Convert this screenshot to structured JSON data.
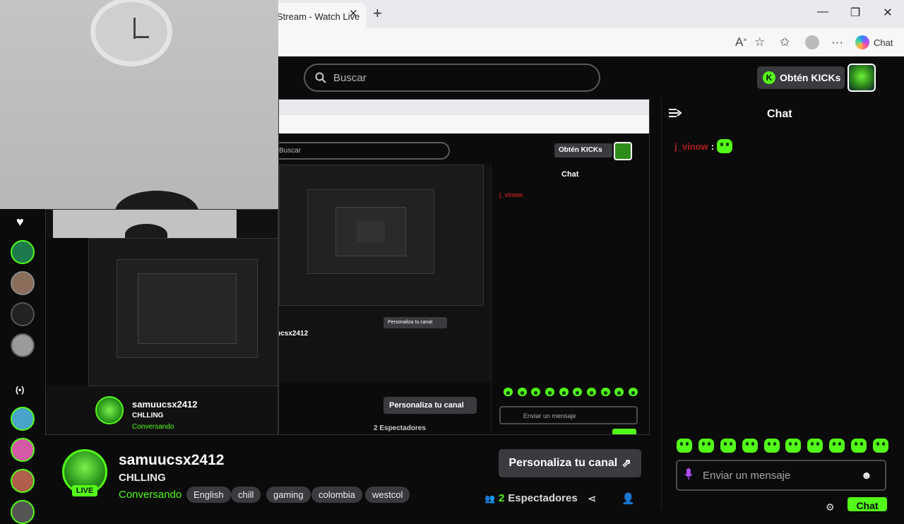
{
  "browser": {
    "tab_title": "Stream - Watch Live",
    "tab_close": "✕",
    "new_tab": "+",
    "min": "—",
    "restore": "❐",
    "close": "✕",
    "copilot_label": "Chat",
    "read_aloud": "A̅",
    "fav": "☆",
    "favs": "✩",
    "more": "···"
  },
  "header": {
    "search_placeholder": "Buscar",
    "kicks_label": "Obtén KICKs",
    "kicks_icon": "K"
  },
  "sidebar": {
    "heart": "♥",
    "live_icon": "(•)"
  },
  "stream": {
    "channel_name": "samuucsx2412",
    "title": "CHLLING",
    "category": "Conversando",
    "live_badge": "LIVE",
    "tags": [
      "English",
      "chill",
      "gaming",
      "colombia",
      "westcol"
    ],
    "customize_label": "Personaliza tu canal",
    "customize_icon": "⇗",
    "viewers_count": "2",
    "viewers_label": "Espectadores",
    "viewers_icon": "👥",
    "share_icon": "⋖",
    "follow_icon": "👤"
  },
  "chat": {
    "title": "Chat",
    "collapse_icon": "≡→",
    "messages": [
      {
        "user": "j_vinow",
        "sep": ":",
        "content": "emote"
      }
    ],
    "input_placeholder": "Enviar un mensaje",
    "mic_icon": "🎙",
    "emoji_icon": "☻",
    "settings_icon": "⚙",
    "send_label": "Chat",
    "emote_count": 10
  },
  "nested": {
    "l1_search": "Buscar",
    "l1_kicks": "Obtén KICKs",
    "l1_chat": "Chat",
    "l1_channel": "samuucsx2412",
    "l1_title": "CHLLING",
    "l1_category": "Conversando",
    "l1_customize": "Personaliza tu canal",
    "l1_viewers": "2 Espectadores",
    "l1_input": "Enviar un mensaje",
    "l1_user": "j_vinow",
    "l2_channel": "samuucsx2412",
    "l2_title": "CHLLING",
    "l2_category": "Conversando",
    "l2_customize": "Personaliza tu canal",
    "l2_viewers": "2 Espectadores",
    "l2_input": "Enviar un mensaje",
    "l2_chat": "Chat"
  },
  "colors": {
    "accent": "#53fc18",
    "bg": "#0b0b0c",
    "chip": "#3a3b3f",
    "username": "#b21e1e"
  }
}
